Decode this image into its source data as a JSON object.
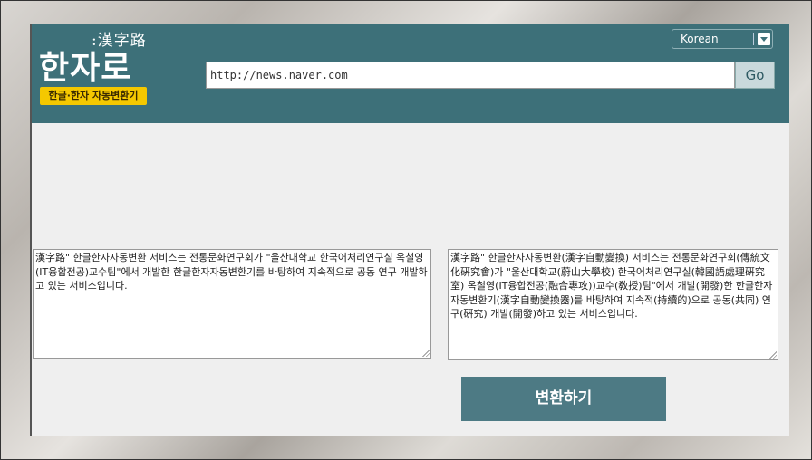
{
  "header": {
    "logo_hanja": ":漢字路",
    "logo_main": "한자로",
    "logo_badge": "한글·한자 자동변환기",
    "language_selected": "Korean",
    "url_value": "http://news.naver.com",
    "go_label": "Go"
  },
  "main": {
    "input_text": "漢字路\" 한글한자자동변환 서비스는 전통문화연구회가 \"울산대학교 한국어처리연구실 옥철영(IT융합전공)교수팀\"에서 개발한 한글한자자동변환기를 바탕하여 지속적으로 공동 연구 개발하고 있는 서비스입니다.",
    "output_text": "漢字路\" 한글한자자동변환(漢字自動變換) 서비스는 전통문화연구회(傳統文化硏究會)가 \"울산대학교(蔚山大學校) 한국어처리연구실(韓國語處理硏究室) 옥철영(IT융합전공(融合專攻))교수(敎授)팀\"에서 개발(開發)한 한글한자자동변환기(漢字自動變換器)를 바탕하여 지속적(持續的)으로 공동(共同) 연구(硏究) 개발(開發)하고 있는 서비스입니다.",
    "convert_label": "변환하기"
  },
  "colors": {
    "header_bg": "#3d7079",
    "badge_bg": "#f5c800",
    "button_bg": "#4d7a84"
  }
}
